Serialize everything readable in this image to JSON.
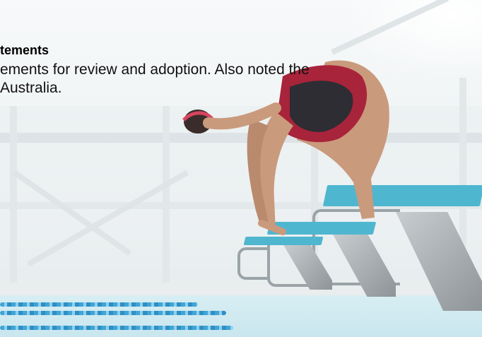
{
  "slide": {
    "heading": "tements",
    "body_line_1": "ements for review and adoption. Also noted the",
    "body_line_2": "Australia."
  },
  "image": {
    "description_icon": "swimmer-on-starting-block-photo"
  },
  "colors": {
    "block_top": "#4fb6cf",
    "lane_rope": "#3fa5d6",
    "suit": "#a8243a"
  }
}
